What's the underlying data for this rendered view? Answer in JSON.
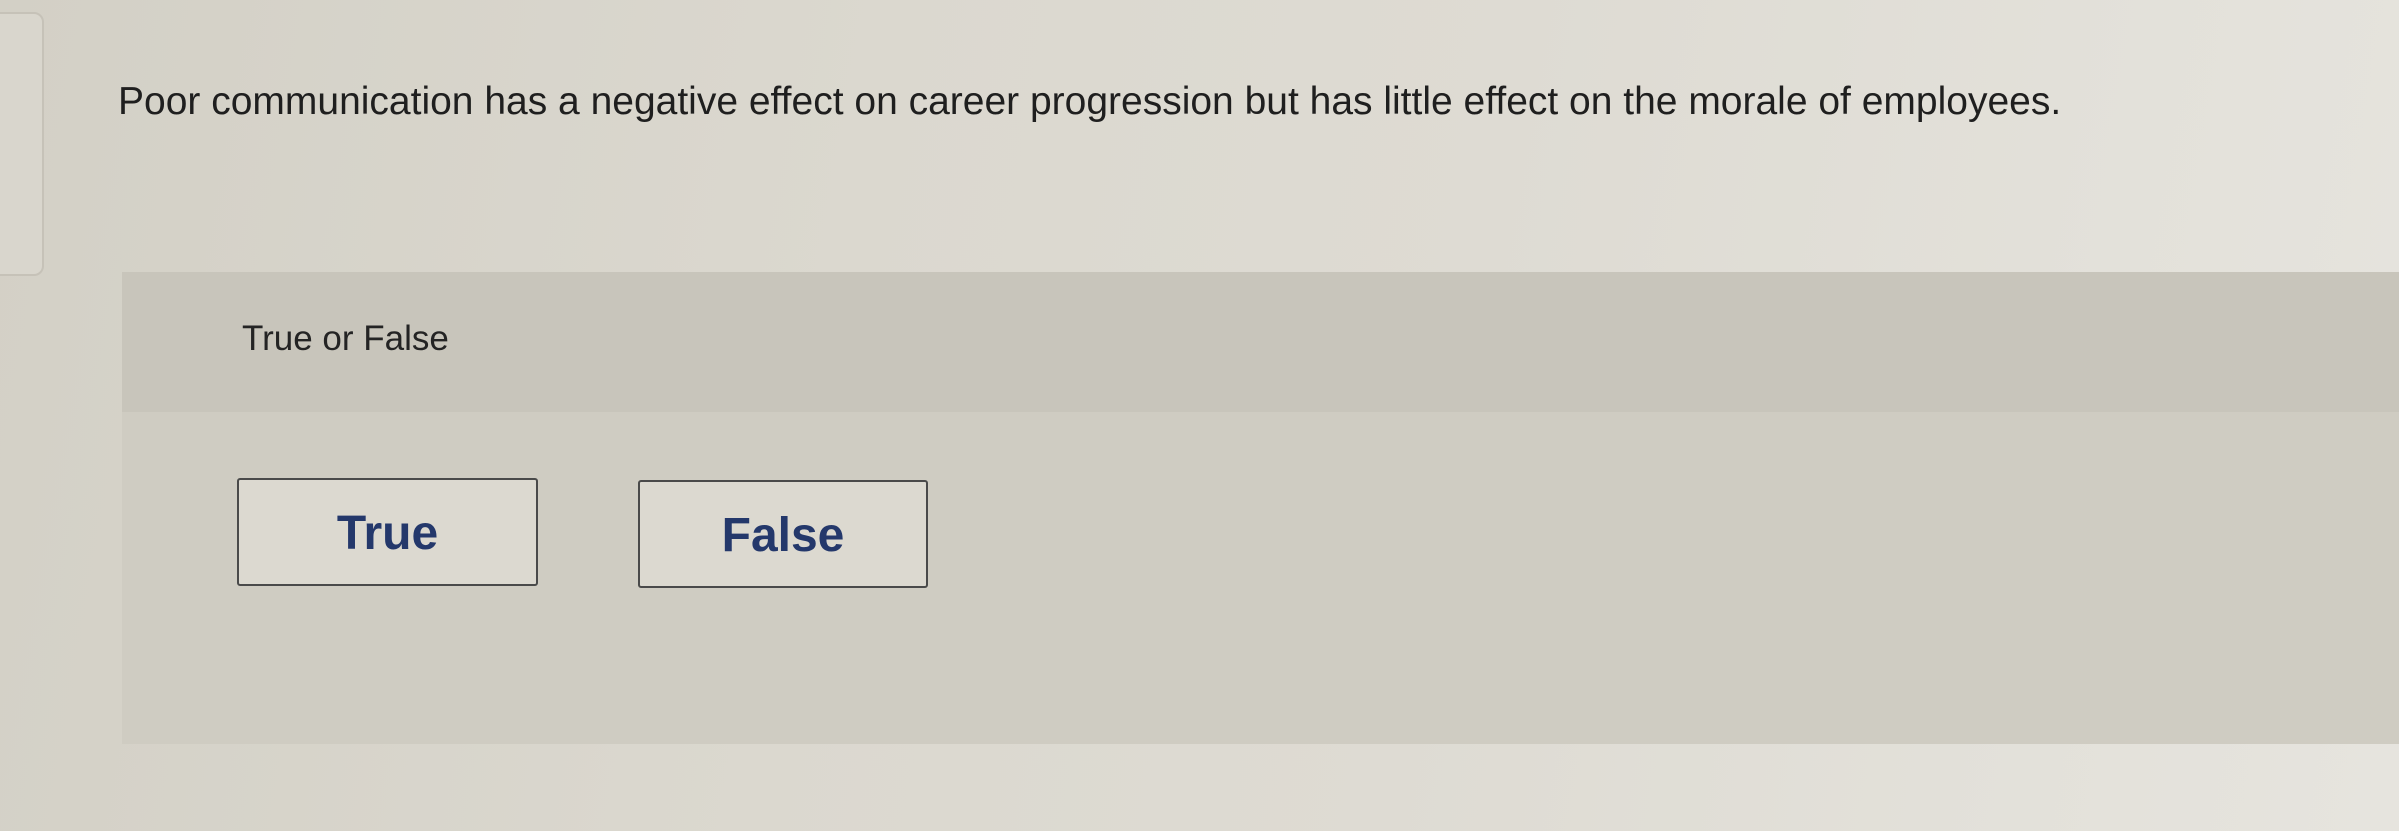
{
  "question": {
    "text": "Poor communication has a negative effect on career progression but has little effect on the morale of employees."
  },
  "answer_panel": {
    "prompt": "True or False",
    "choices": [
      {
        "label": "True"
      },
      {
        "label": "False"
      }
    ]
  },
  "colors": {
    "button_text": "#24386b",
    "button_border": "#4a4a4a",
    "panel_background": "#cfccc2"
  }
}
